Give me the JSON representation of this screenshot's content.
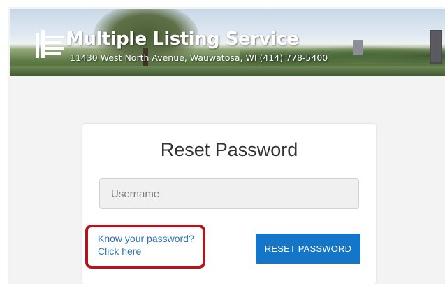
{
  "header": {
    "title": "Multiple Listing Service",
    "address": "11430 West North Avenue, Wauwatosa, WI (414) 778-5400",
    "logo_icon": "building-logo-icon"
  },
  "form": {
    "title": "Reset Password",
    "username_placeholder": "Username",
    "username_value": "",
    "link_line1": "Know your password?",
    "link_line2": "Click here",
    "button_label": "RESET PASSWORD"
  },
  "colors": {
    "accent": "#1476c8",
    "link": "#2f73b8",
    "highlight": "#b3141e"
  }
}
